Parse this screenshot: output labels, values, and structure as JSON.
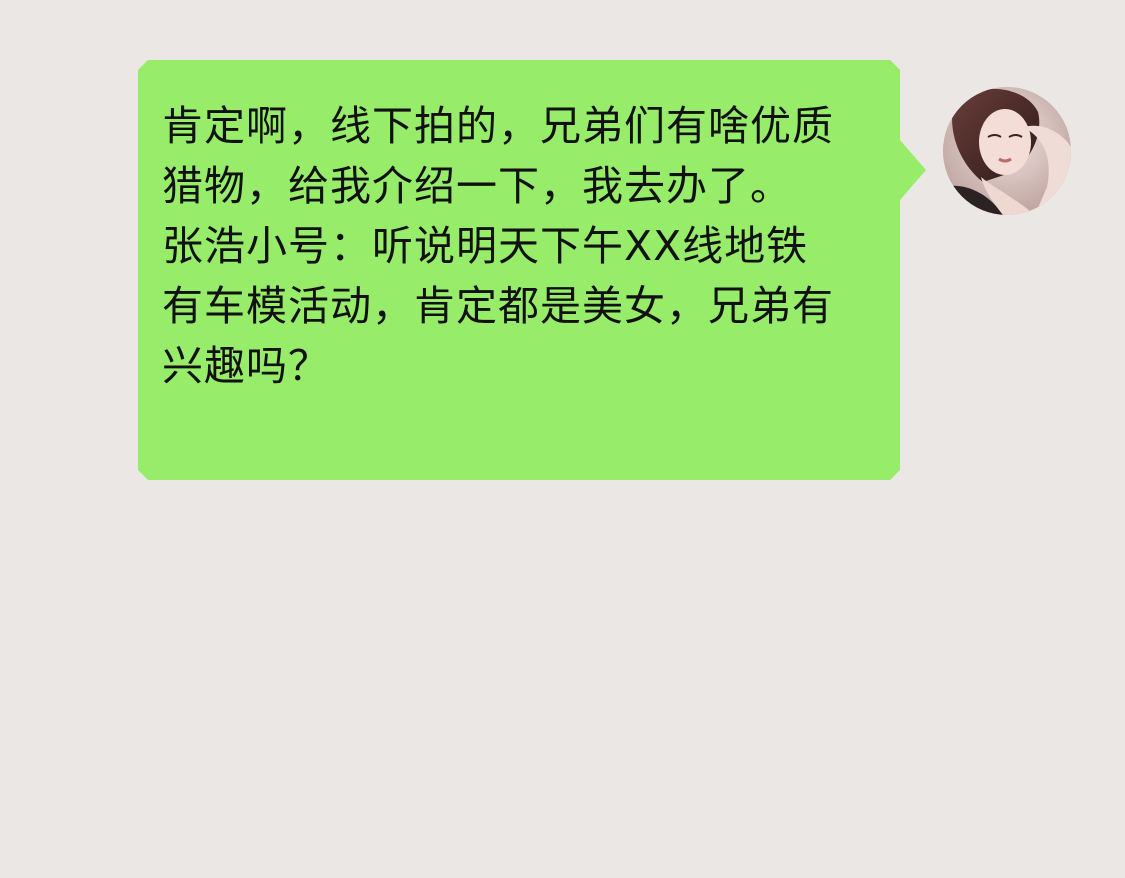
{
  "chat": {
    "message": {
      "sender": "self",
      "bubble_color": "#97ec69",
      "lines": [
        "肯定啊，线下拍的，兄弟们有啥优质",
        "猎物，给我介绍一下，我去办了。",
        "张浩小号：听说明天下午XX线地铁",
        "有车模活动，肯定都是美女，兄弟有",
        "兴趣吗？"
      ]
    },
    "avatar": {
      "icon": "user-avatar-photo"
    },
    "background_color": "#ebe7e5"
  }
}
